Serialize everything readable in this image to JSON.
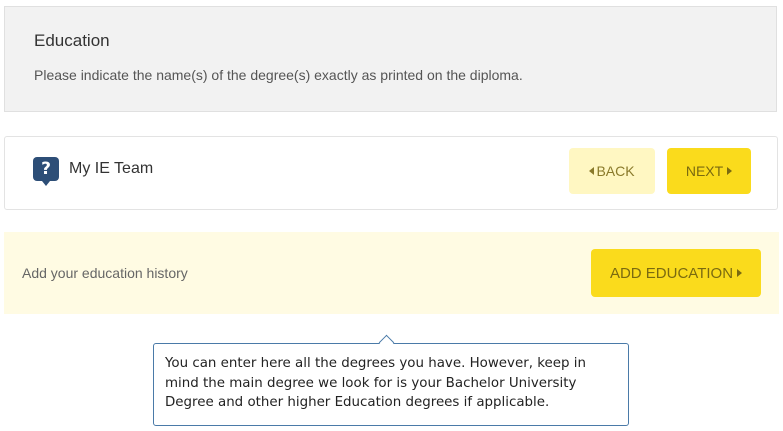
{
  "header": {
    "title": "Education",
    "subtitle": "Please indicate the name(s) of the degree(s) exactly as printed on the diploma."
  },
  "team": {
    "icon": "question-mark-icon",
    "icon_glyph": "?",
    "label": "My IE Team",
    "back_label": "BACK",
    "next_label": "NEXT"
  },
  "education": {
    "history_label": "Add your education history",
    "add_label": "ADD EDUCATION"
  },
  "tooltip": {
    "text": "You can enter here all the degrees you have. However, keep in mind the main degree we look for is your Bachelor University Degree and other higher Education degrees if applicable."
  },
  "colors": {
    "accent_yellow": "#fadb1c",
    "light_yellow": "#fff7c2",
    "panel_yellow": "#fffbe3",
    "icon_blue": "#2d4e77",
    "tooltip_border": "#4a7aa8"
  }
}
